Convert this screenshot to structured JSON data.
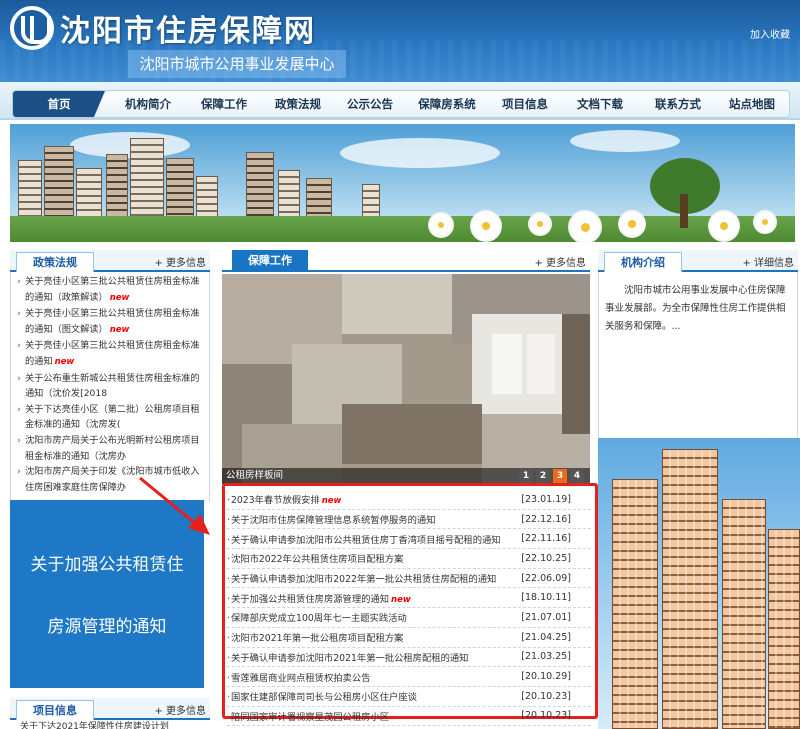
{
  "header": {
    "site_title": "沈阳市住房保障网",
    "subtitle": "沈阳市城市公用事业发展中心",
    "favorite_link": "加入收藏"
  },
  "nav": {
    "items": [
      "首页",
      "机构简介",
      "保障工作",
      "政策法规",
      "公示公告",
      "保障房系统",
      "项目信息",
      "文档下载",
      "联系方式",
      "站点地图"
    ],
    "active": "首页"
  },
  "policy": {
    "title": "政策法规",
    "more": "+ 更多信息",
    "items": [
      {
        "text": "关于亮佳小区第三批公共租赁住房租金标准的通知（政策解读）",
        "new": "new"
      },
      {
        "text": "关于亮佳小区第三批公共租赁住房租金标准的通知（图文解读）",
        "new": "new"
      },
      {
        "text": "关于亮佳小区第三批公共租赁住房租金标准的通知",
        "new": "new"
      },
      {
        "text": "关于公布重生新城公共租赁住房租金标准的通知（沈价发[2018",
        "new": ""
      },
      {
        "text": "关于下达亮佳小区（第二批）公租房项目租金标准的通知（沈房发(",
        "new": ""
      },
      {
        "text": "沈阳市房产局关于公布光明新村公租房项目租金标准的通知（沈房办",
        "new": ""
      },
      {
        "text": "沈阳市房产局关于印发《沈阳市城市低收入住房困难家庭住房保障办",
        "new": ""
      }
    ]
  },
  "promo": {
    "line1": "关于加强公共租赁住",
    "line2": "房源管理的通知"
  },
  "project_info": {
    "title": "项目信息",
    "more": "+ 更多信息",
    "first_item": "关于下达2021年保障性住房建设计划"
  },
  "work": {
    "title": "保障工作",
    "more": "+ 更多信息",
    "photo_caption": "公租房样板间",
    "pager": [
      "1",
      "2",
      "3",
      "4"
    ],
    "pager_active": "3"
  },
  "notices": [
    {
      "title": "2023年春节放假安排",
      "new": "new",
      "date": "[23.01.19]"
    },
    {
      "title": "关于沈阳市住房保障管理信息系统暂停服务的通知",
      "new": "",
      "date": "[22.12.16]"
    },
    {
      "title": "关于确认申请参加沈阳市公共租赁住房丁香湾项目摇号配租的通知",
      "new": "",
      "date": "[22.11.16]"
    },
    {
      "title": "沈阳市2022年公共租赁住房项目配租方案",
      "new": "",
      "date": "[22.10.25]"
    },
    {
      "title": "关于确认申请参加沈阳市2022年第一批公共租赁住房配租的通知",
      "new": "",
      "date": "[22.06.09]"
    },
    {
      "title": "关于加强公共租赁住房房源管理的通知",
      "new": "new",
      "date": "[18.10.11]"
    },
    {
      "title": "保障部庆党成立100周年七一主题实践活动",
      "new": "",
      "date": "[21.07.01]"
    },
    {
      "title": "沈阳市2021年第一批公租房项目配租方案",
      "new": "",
      "date": "[21.04.25]"
    },
    {
      "title": "关于确认申请参加沈阳市2021年第一批公租房配租的通知",
      "new": "",
      "date": "[21.03.25]"
    },
    {
      "title": "雪莲雅居商业网点租赁权拍卖公告",
      "new": "",
      "date": "[20.10.29]"
    },
    {
      "title": "国家住建部保障司司长与公租房小区住户座谈",
      "new": "",
      "date": "[20.10.23]"
    },
    {
      "title": "陪同国家审计署视察星茂园公租房小区",
      "new": "",
      "date": "[20.10.23]"
    }
  ],
  "org": {
    "title": "机构介绍",
    "more": "+ 详细信息",
    "text": "沈阳市城市公用事业发展中心住房保障事业发展部。为全市保障性住房工作提供相关服务和保障。..."
  },
  "colors": {
    "header_blue": "#2a78c2",
    "nav_active": "#1b4f86",
    "tab_blue": "#1a74c4",
    "highlight_red": "#e6201c",
    "new_badge": "#e00000"
  }
}
